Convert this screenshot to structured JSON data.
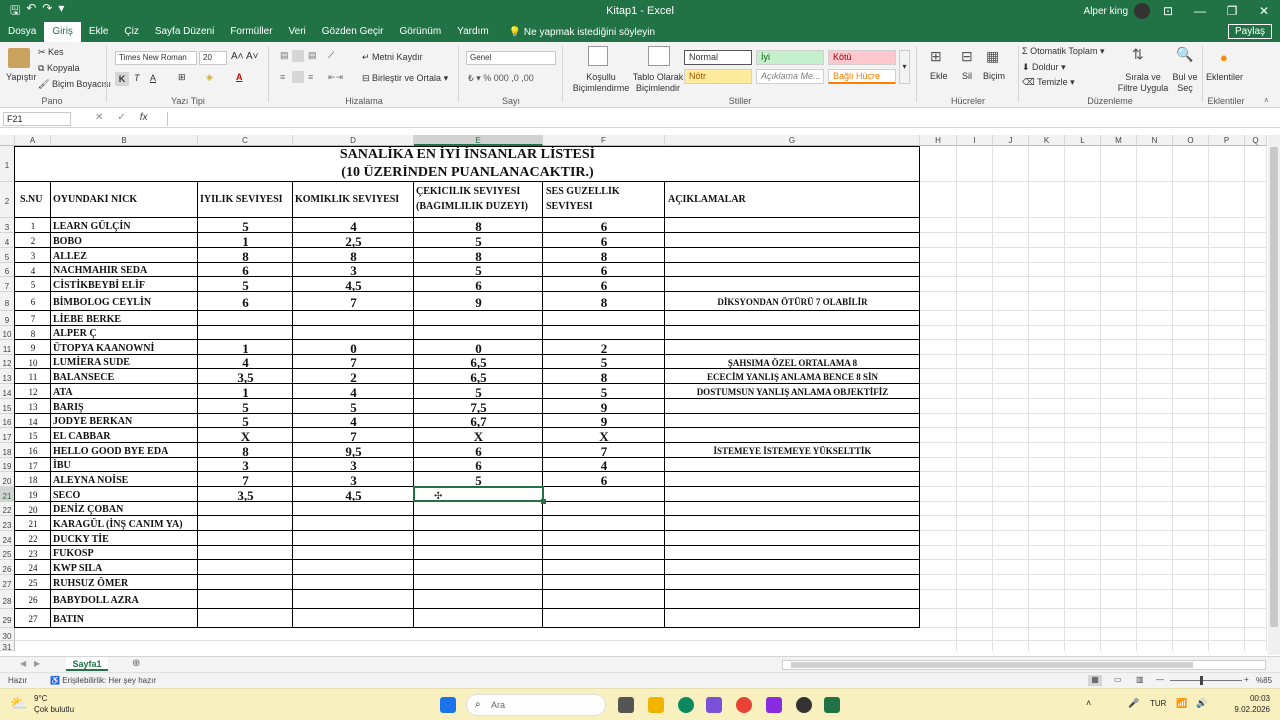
{
  "window": {
    "title": "Kitap1 - Excel",
    "user": "Alper king",
    "minimize": "—",
    "restore": "❐",
    "close": "✕",
    "ribbon_display": "⊡"
  },
  "menu": {
    "items": [
      "Dosya",
      "Giriş",
      "Ekle",
      "Çiz",
      "Sayfa Düzeni",
      "Formüller",
      "Veri",
      "Gözden Geçir",
      "Görünüm",
      "Yardım"
    ],
    "tell_me": "Ne yapmak istediğini söyleyin",
    "share": "Paylaş"
  },
  "ribbon": {
    "clipboard": {
      "paste": "Yapıştır",
      "cut": "Kes",
      "copy": "Kopyala",
      "format_painter": "Biçim Boyacısı",
      "label": "Pano"
    },
    "font": {
      "name": "Times New Roman",
      "size": "20",
      "bold": "K",
      "italic": "T",
      "underline": "A",
      "label": "Yazı Tipi"
    },
    "alignment": {
      "wrap": "Metni Kaydır",
      "merge": "Birleştir ve Ortala",
      "label": "Hizalama"
    },
    "number": {
      "format": "Genel",
      "label": "Sayı"
    },
    "styles": {
      "conditional": "Koşullu Biçimlendirme",
      "table": "Tablo Olarak Biçimlendir",
      "normal": "Normal",
      "good": "İyi",
      "bad": "Kötü",
      "neutral": "Nötr",
      "explanatory": "Açıklama Me...",
      "linked": "Bağlı Hücre",
      "label": "Stiller"
    },
    "cells": {
      "insert": "Ekle",
      "delete": "Sil",
      "format": "Biçim",
      "label": "Hücreler"
    },
    "editing": {
      "autosum": "Otomatik Toplam",
      "fill": "Doldur",
      "clear": "Temizle",
      "sort": "Sırala ve Filtre Uygula",
      "find": "Bul ve Seç",
      "label": "Düzenleme"
    },
    "addins": {
      "addins": "Eklentiler",
      "label": "Eklentiler"
    }
  },
  "formula_bar": {
    "name_box": "F21",
    "cancel": "✕",
    "enter": "✓",
    "fx": "fx",
    "value": ""
  },
  "columns": [
    "A",
    "B",
    "C",
    "D",
    "E",
    "F",
    "G",
    "H",
    "I",
    "J",
    "K",
    "L",
    "M",
    "N",
    "O",
    "P",
    "Q"
  ],
  "row_numbers": [
    "1",
    "2",
    "3",
    "4",
    "5",
    "6",
    "7",
    "8",
    "9",
    "10",
    "11",
    "12",
    "13",
    "14",
    "15",
    "16",
    "17",
    "18",
    "19",
    "20",
    "21",
    "22",
    "23",
    "24",
    "25",
    "26",
    "27",
    "28",
    "29",
    "30",
    "31"
  ],
  "sheet": {
    "title_line1": "SANALİKA EN İYİ İNSANLAR LİSTESİ",
    "title_line2": "(10 ÜZERİNDEN PUANLANACAKTIR.)",
    "headers": {
      "sno": "S.NU",
      "nick": "OYUNDAKİ NİCK",
      "iyilik": "İYİLİK SEVİYESİ",
      "komiklik": "KOMİKLİK SEVİYESİ",
      "cekicilik1": "ÇEKİCİLİK SEVİYESİ",
      "cekicilik2": "(BAĞIMLILIK DÜZEYİ)",
      "ses1": "SES GÜZELLİK",
      "ses2": "SEVİYESİ",
      "aciklama": "AÇIKLAMALAR"
    },
    "rows": [
      {
        "n": "1",
        "nick": "LEARN GÜLÇİN",
        "c": "5",
        "d": "4",
        "e": "8",
        "f": "6",
        "g": ""
      },
      {
        "n": "2",
        "nick": "BOBO",
        "c": "1",
        "d": "2,5",
        "e": "5",
        "f": "6",
        "g": ""
      },
      {
        "n": "3",
        "nick": "ALLEZ",
        "c": "8",
        "d": "8",
        "e": "8",
        "f": "8",
        "g": ""
      },
      {
        "n": "4",
        "nick": "NACHMAHIR SEDA",
        "c": "6",
        "d": "3",
        "e": "5",
        "f": "6",
        "g": ""
      },
      {
        "n": "5",
        "nick": "CİSTİKBEYBİ ELİF",
        "c": "5",
        "d": "4,5",
        "e": "6",
        "f": "6",
        "g": ""
      },
      {
        "n": "6",
        "nick": "BİMBOLOG CEYLİN",
        "c": "6",
        "d": "7",
        "e": "9",
        "f": "8",
        "g": "DİKSYONDAN ÖTÜRÜ 7 OLABİLİR"
      },
      {
        "n": "7",
        "nick": "LİEBE BERKE",
        "c": "",
        "d": "",
        "e": "",
        "f": "",
        "g": ""
      },
      {
        "n": "8",
        "nick": "ALPER Ç",
        "c": "",
        "d": "",
        "e": "",
        "f": "",
        "g": ""
      },
      {
        "n": "9",
        "nick": "ÜTOPYA KAANOWNİ",
        "c": "1",
        "d": "0",
        "e": "0",
        "f": "2",
        "g": ""
      },
      {
        "n": "10",
        "nick": "LUMİERA SUDE",
        "c": "4",
        "d": "7",
        "e": "6,5",
        "f": "5",
        "g": "ŞAHSIMA ÖZEL ORTALAMA 8"
      },
      {
        "n": "11",
        "nick": "BALANSECE",
        "c": "3,5",
        "d": "2",
        "e": "6,5",
        "f": "8",
        "g": "ECECİM YANLIŞ ANLAMA BENCE 8 SİN"
      },
      {
        "n": "12",
        "nick": "ATA",
        "c": "1",
        "d": "4",
        "e": "5",
        "f": "5",
        "g": "DOSTUMSUN YANLIŞ ANLAMA OBJEKTİFİZ"
      },
      {
        "n": "13",
        "nick": "BARIŞ",
        "c": "5",
        "d": "5",
        "e": "7,5",
        "f": "9",
        "g": ""
      },
      {
        "n": "14",
        "nick": "JODYE BERKAN",
        "c": "5",
        "d": "4",
        "e": "6,7",
        "f": "9",
        "g": ""
      },
      {
        "n": "15",
        "nick": "EL CABBAR",
        "c": "X",
        "d": "7",
        "e": "X",
        "f": "X",
        "g": ""
      },
      {
        "n": "16",
        "nick": "HELLO GOOD BYE EDA",
        "c": "8",
        "d": "9,5",
        "e": "6",
        "f": "7",
        "g": "İSTEMEYE İSTEMEYE YÜKSELTTİK"
      },
      {
        "n": "17",
        "nick": "İBU",
        "c": "3",
        "d": "3",
        "e": "6",
        "f": "4",
        "g": ""
      },
      {
        "n": "18",
        "nick": "ALEYNA NOİSE",
        "c": "7",
        "d": "3",
        "e": "5",
        "f": "6",
        "g": ""
      },
      {
        "n": "19",
        "nick": "SECO",
        "c": "3,5",
        "d": "4,5",
        "e": "",
        "f": "",
        "g": ""
      },
      {
        "n": "20",
        "nick": "DENİZ ÇOBAN",
        "c": "",
        "d": "",
        "e": "",
        "f": "",
        "g": ""
      },
      {
        "n": "21",
        "nick": "KARAGÜL (İNŞ CANIM YA)",
        "c": "",
        "d": "",
        "e": "",
        "f": "",
        "g": ""
      },
      {
        "n": "22",
        "nick": "DUCKY TİE",
        "c": "",
        "d": "",
        "e": "",
        "f": "",
        "g": ""
      },
      {
        "n": "23",
        "nick": "FUKOSP",
        "c": "",
        "d": "",
        "e": "",
        "f": "",
        "g": ""
      },
      {
        "n": "24",
        "nick": "KWP SILA",
        "c": "",
        "d": "",
        "e": "",
        "f": "",
        "g": ""
      },
      {
        "n": "25",
        "nick": "RUHSUZ ÖMER",
        "c": "",
        "d": "",
        "e": "",
        "f": "",
        "g": ""
      },
      {
        "n": "26",
        "nick": "BABYDOLL AZRA",
        "c": "",
        "d": "",
        "e": "",
        "f": "",
        "g": ""
      },
      {
        "n": "27",
        "nick": "BATIN",
        "c": "",
        "d": "",
        "e": "",
        "f": "",
        "g": ""
      }
    ]
  },
  "sheet_tabs": {
    "active": "Sayfa1",
    "add": "⊕"
  },
  "status": {
    "ready": "Hazır",
    "accessibility": "Erişilebilirlik: Her şey hazır",
    "zoom": "%85"
  },
  "taskbar": {
    "weather_temp": "9°C",
    "weather_desc": "Çok bulutlu",
    "search": "Ara",
    "lang": "TUR",
    "time": "00:03",
    "date": "9.02.2026"
  }
}
